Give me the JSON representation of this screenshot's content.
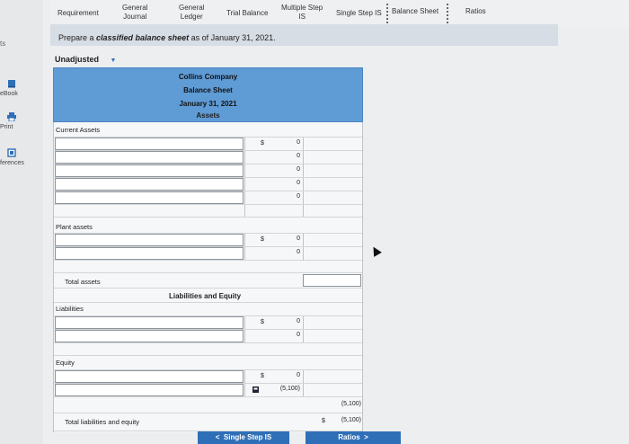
{
  "sidebar": {
    "num": "ts",
    "items": [
      {
        "label": "eBook",
        "icon": "book-icon"
      },
      {
        "label": "Print",
        "icon": "print-icon"
      },
      {
        "label": "ferences",
        "icon": "references-icon"
      }
    ]
  },
  "tabs": [
    {
      "label": "Requirement"
    },
    {
      "label": "General\nJournal"
    },
    {
      "label": "General\nLedger"
    },
    {
      "label": "Trial Balance"
    },
    {
      "label": "Multiple Step\nIS"
    },
    {
      "label": "Single Step IS"
    },
    {
      "label": "Balance Sheet"
    },
    {
      "label": "Ratios"
    }
  ],
  "instruction": {
    "pre": "Prepare a ",
    "em": "classified balance sheet",
    "post": " as of January 31, 2021."
  },
  "dropdown": {
    "value": "Unadjusted"
  },
  "sheet": {
    "company": "Collins Company",
    "title": "Balance Sheet",
    "date": "January 31, 2021",
    "assets_header": "Assets",
    "current_assets": "Current Assets",
    "plant_assets": "Plant assets",
    "total_assets": "Total assets",
    "liab_equity_header": "Liabilities and Equity",
    "liabilities": "Liabilities",
    "equity": "Equity",
    "total_le": "Total liabilities and equity",
    "dollar": "$",
    "zero": "0",
    "equity_neg": "(5,100)",
    "subtotal": "(5,100)",
    "total": "(5,100)"
  },
  "nav": {
    "prev": "Single Step IS",
    "next": "Ratios"
  }
}
